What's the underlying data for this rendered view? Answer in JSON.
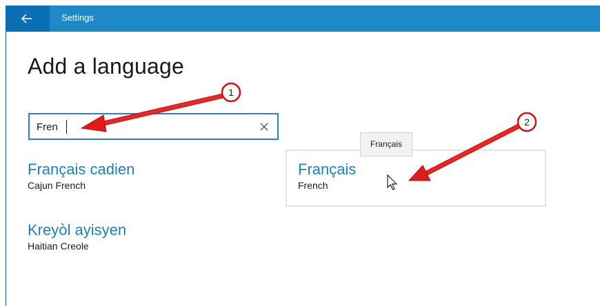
{
  "window": {
    "title": "Settings",
    "back_icon": "back-arrow-icon"
  },
  "colors": {
    "titlebar": "#1e88c9",
    "back_button": "#0b6fb6",
    "accent": "#1c7fc4",
    "annotation_arrow": "#e01b1b"
  },
  "page": {
    "title": "Add a language"
  },
  "search": {
    "value": "Fren",
    "clear_icon": "close-icon"
  },
  "results": [
    {
      "name": "Français cadien",
      "subtitle": "Cajun French"
    },
    {
      "name": "Français",
      "subtitle": "French",
      "hovered": true
    },
    {
      "name": "Kreyòl ayisyen",
      "subtitle": "Haitian Creole"
    }
  ],
  "tooltip": {
    "text": "Français"
  },
  "annotations": [
    {
      "label": "1"
    },
    {
      "label": "2"
    }
  ]
}
